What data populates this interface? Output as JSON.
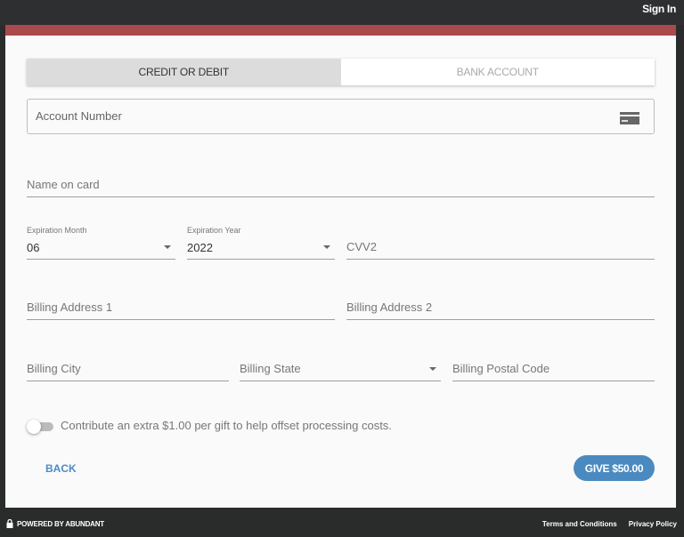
{
  "header": {
    "sign_in": "Sign In"
  },
  "tabs": [
    {
      "label": "CREDIT OR DEBIT",
      "active": true
    },
    {
      "label": "BANK ACCOUNT",
      "active": false
    }
  ],
  "form": {
    "account_number": {
      "placeholder": "Account Number",
      "icon": "credit-card-icon"
    },
    "name_on_card": {
      "placeholder": "Name on card"
    },
    "expiration_month": {
      "label": "Expiration Month",
      "value": "06"
    },
    "expiration_year": {
      "label": "Expiration Year",
      "value": "2022"
    },
    "cvv2": {
      "placeholder": "CVV2"
    },
    "billing_address_1": {
      "placeholder": "Billing Address 1"
    },
    "billing_address_2": {
      "placeholder": "Billing Address 2"
    },
    "billing_city": {
      "placeholder": "Billing City"
    },
    "billing_state": {
      "placeholder": "Billing State"
    },
    "billing_postal_code": {
      "placeholder": "Billing Postal Code"
    },
    "processing_fee_toggle": {
      "label": "Contribute an extra $1.00 per gift to help offset processing costs.",
      "on": false
    }
  },
  "actions": {
    "back": "BACK",
    "give": "GIVE $50.00"
  },
  "footer": {
    "powered_by": "POWERED BY ABUNDANT",
    "terms": "Terms and Conditions",
    "privacy": "Privacy Policy"
  },
  "colors": {
    "accent": "#a94b4d",
    "primary": "#4b8ac1"
  }
}
